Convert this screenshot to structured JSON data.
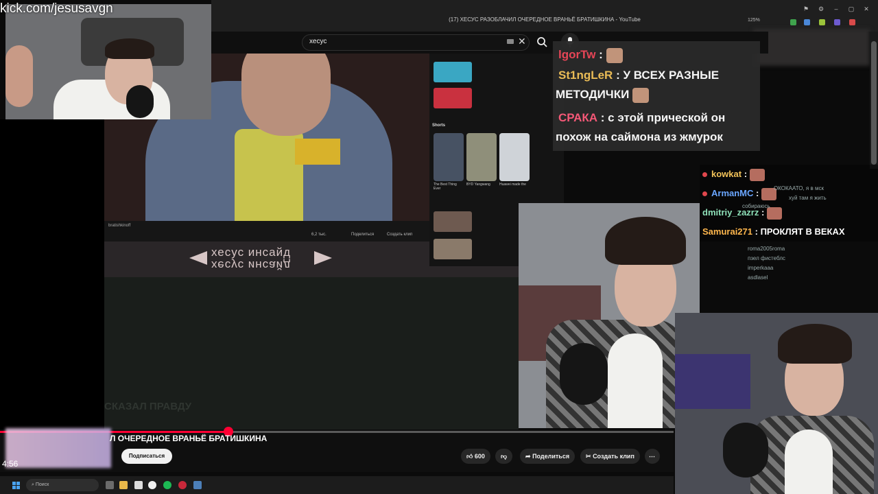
{
  "overlay": {
    "kick_url": "kick.com/jesusavgn",
    "time_code": "4:56"
  },
  "browser": {
    "tab_title": "(17) ХЕСУС РАЗОБЛАЧИЛ ОЧЕРЕДНОЕ ВРАНЬЁ БРАТИШКИНА - YouTube",
    "zoom": "125%"
  },
  "search": {
    "query": "хесус"
  },
  "video": {
    "channel": "bratishkinoff",
    "likes_small": "6,2 тыс.",
    "share_small": "Поделиться",
    "clip_small": "Создать клип",
    "title": "Л ОЧЕРЕДНОЕ ВРАНЬЁ БРАТИШКИНА",
    "faded_text": "СКАЗАЛ ПРАВДУ"
  },
  "banner": {
    "line1": "хесус инсайд",
    "line2": "хесус инсайд"
  },
  "related": {
    "shorts_label": "Shorts",
    "shorts": [
      {
        "title": "The Best Thing Ever"
      },
      {
        "title": "BYD Yangwang"
      },
      {
        "title": "Huawei made the"
      }
    ]
  },
  "actions": {
    "subscribe": "Подписаться",
    "likes": "600",
    "share": "Поделиться",
    "clip": "Создать клип"
  },
  "chat_big": [
    {
      "user": "lgorTw",
      "text": "",
      "color": "#f0485a"
    },
    {
      "user": "St1ngLeR",
      "text": "У ВСЕХ РАЗНЫЕ",
      "text2": "МЕТОДИЧКИ",
      "color": "#f3c35a"
    },
    {
      "user": "СРАКА",
      "text": "с этой прической он",
      "text2": "похож на саймона из жмурок",
      "color": "#ff5c7c"
    }
  ],
  "chat_small": [
    {
      "user": "kowkat",
      "text": "",
      "color": "#f3c35a"
    },
    {
      "user": "ArmanMC",
      "text": "",
      "color": "#6aa6ff"
    },
    {
      "user": "dmitriy_zazrz",
      "text": "",
      "color": "#8ee0b8"
    },
    {
      "user": "Samurai271",
      "text": "ПРОКЛЯТ В ВЕКАХ",
      "color": "#ffb74d"
    }
  ],
  "chat_faint": [
    "ОКОКААТО, я в мск",
    "хуй там я жить",
    "собираюсь",
    "roma2005roma",
    "пзел фистеблс",
    "imperkaaa",
    "asdlasel"
  ],
  "taskbar": {
    "search_label": "Поиск"
  },
  "colors": {
    "accent": "#ff0033",
    "chat_bg": "#2a2a2a"
  }
}
